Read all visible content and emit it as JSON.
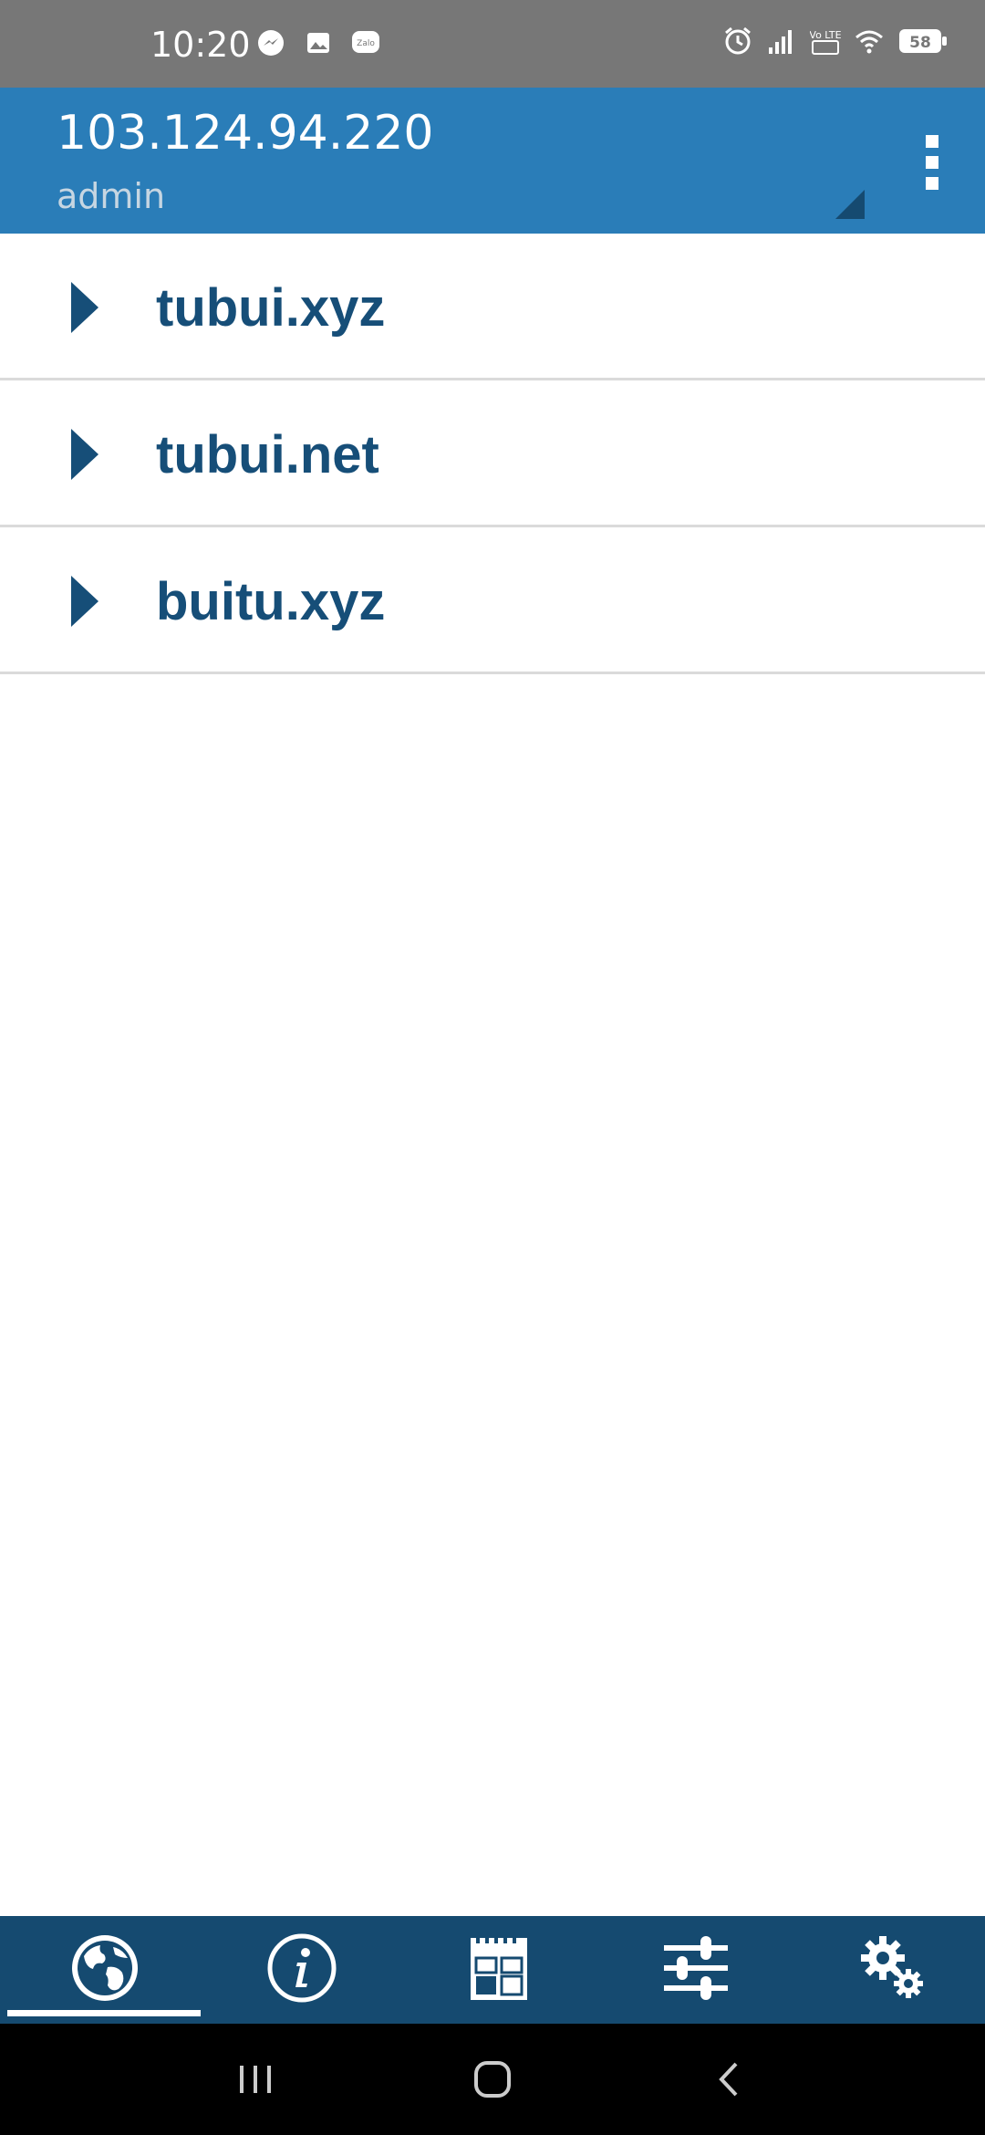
{
  "status_bar": {
    "time": "10:20",
    "left_icons": [
      "messenger-icon",
      "gallery-icon",
      "zalo-icon"
    ],
    "zalo_text": "Zalo",
    "right_icons": [
      "alarm-icon",
      "signal-icon",
      "volte-icon",
      "wifi-icon",
      "battery-icon"
    ],
    "volte_text": "Vo LTE",
    "battery_level": "58"
  },
  "app_bar": {
    "title": "103.124.94.220",
    "subtitle": "admin"
  },
  "domains": [
    {
      "label": "tubui.xyz"
    },
    {
      "label": "tubui.net"
    },
    {
      "label": "buitu.xyz"
    }
  ],
  "bottom_nav": {
    "items": [
      {
        "icon": "globe-icon",
        "active": true
      },
      {
        "icon": "info-icon",
        "active": false
      },
      {
        "icon": "calendar-grid-icon",
        "active": false
      },
      {
        "icon": "sliders-icon",
        "active": false
      },
      {
        "icon": "gears-icon",
        "active": false
      }
    ]
  },
  "colors": {
    "status_bar": "#777777",
    "app_bar": "#2a7db8",
    "list_text": "#164e78",
    "bottom_nav": "#154a70",
    "divider": "#dadada"
  }
}
